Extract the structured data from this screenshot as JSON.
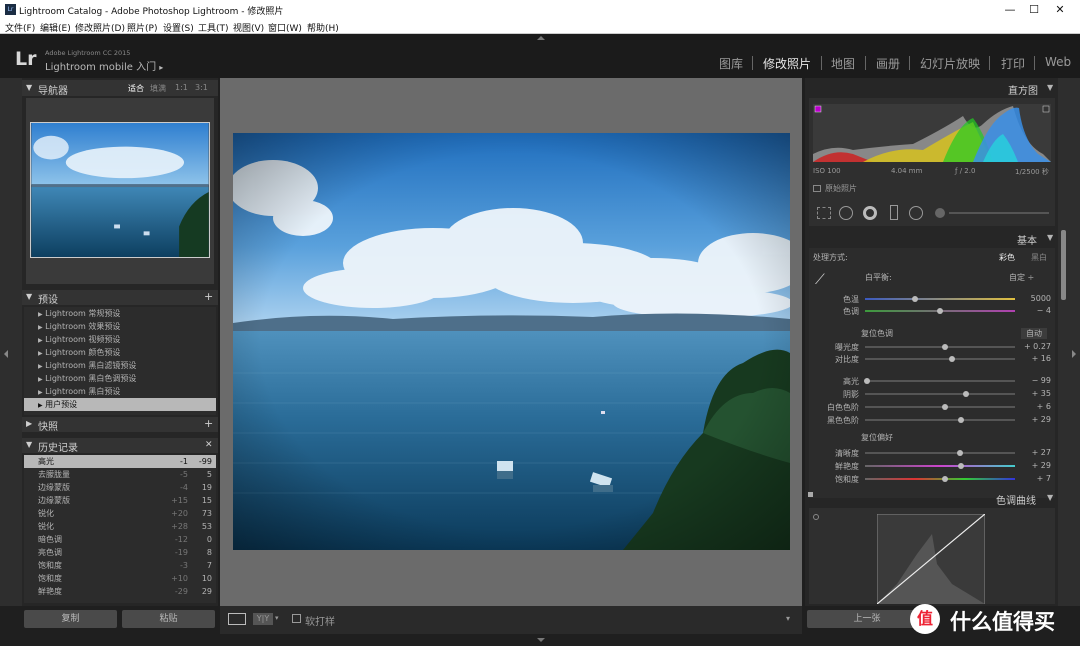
{
  "window": {
    "title": "Lightroom Catalog - Adobe Photoshop Lightroom - 修改照片",
    "min": "—",
    "max": "☐",
    "close": "✕"
  },
  "menu": [
    "文件(F)",
    "编辑(E)",
    "修改照片(D)",
    "照片(P)",
    "设置(S)",
    "工具(T)",
    "视图(V)",
    "窗口(W)",
    "帮助(H)"
  ],
  "identity": {
    "logo": "Lr",
    "line1": "Adobe Lightroom CC 2015",
    "line2": "Lightroom mobile 入门",
    "arrow": "▸"
  },
  "modules": [
    "图库",
    "修改照片",
    "地图",
    "画册",
    "幻灯片放映",
    "打印",
    "Web"
  ],
  "navigator": {
    "title": "导航器",
    "fit": "适合",
    "fill": "填满",
    "r1": "1:1",
    "r3": "3:1"
  },
  "presets": {
    "title": "预设",
    "add": "+",
    "items": [
      "Lightroom 常规预设",
      "Lightroom 效果预设",
      "Lightroom 视频预设",
      "Lightroom 颜色预设",
      "Lightroom 黑白滤镜预设",
      "Lightroom 黑白色调预设",
      "Lightroom 黑白预设",
      "用户预设"
    ]
  },
  "snapshots": {
    "title": "快照",
    "add": "+"
  },
  "history": {
    "title": "历史记录",
    "close": "✕",
    "items": [
      {
        "n": "高光",
        "a": "-1",
        "b": "-99"
      },
      {
        "n": "去朦胧量",
        "a": "-5",
        "b": "5"
      },
      {
        "n": "边缘蒙版",
        "a": "-4",
        "b": "19"
      },
      {
        "n": "边缘蒙版",
        "a": "+15",
        "b": "15"
      },
      {
        "n": "锐化",
        "a": "+20",
        "b": "73"
      },
      {
        "n": "锐化",
        "a": "+28",
        "b": "53"
      },
      {
        "n": "暗色调",
        "a": "-12",
        "b": "0"
      },
      {
        "n": "亮色调",
        "a": "-19",
        "b": "8"
      },
      {
        "n": "饱和度",
        "a": "-3",
        "b": "7"
      },
      {
        "n": "饱和度",
        "a": "+10",
        "b": "10"
      },
      {
        "n": "鲜艳度",
        "a": "-29",
        "b": "29"
      }
    ]
  },
  "left_buttons": {
    "copy": "复制",
    "paste": "粘贴"
  },
  "toolbar": {
    "softproof": "软打样"
  },
  "histogram": {
    "title": "直方图",
    "iso": "ISO 100",
    "focal": "4.04 mm",
    "aperture": "ƒ / 2.0",
    "shutter": "1/2500 秒",
    "original": "原始照片"
  },
  "basic": {
    "title": "基本",
    "treatment": "处理方式:",
    "color": "彩色",
    "bw": "黑白",
    "wb": "白平衡:",
    "wb_val": "自定 ÷",
    "temp": {
      "label": "色温",
      "val": "5000",
      "pos": 0.33
    },
    "tint": {
      "label": "色调",
      "val": "− 4",
      "pos": 0.5
    },
    "tone": "复位色调",
    "auto": "自动",
    "tone_sliders": [
      {
        "label": "曝光度",
        "val": "+ 0.27",
        "pos": 0.53
      },
      {
        "label": "对比度",
        "val": "+ 16",
        "pos": 0.58
      }
    ],
    "hl_sliders": [
      {
        "label": "高光",
        "val": "− 99",
        "pos": 0.01
      },
      {
        "label": "阴影",
        "val": "+ 35",
        "pos": 0.67
      },
      {
        "label": "白色色阶",
        "val": "+ 6",
        "pos": 0.53
      },
      {
        "label": "黑色色阶",
        "val": "+ 29",
        "pos": 0.64
      }
    ],
    "presence": "复位偏好",
    "pres_sliders": [
      {
        "label": "清晰度",
        "val": "+ 27",
        "pos": 0.63
      },
      {
        "label": "鲜艳度",
        "val": "+ 29",
        "pos": 0.64
      },
      {
        "label": "饱和度",
        "val": "+ 7",
        "pos": 0.53
      }
    ]
  },
  "curve": {
    "title": "色调曲线"
  },
  "right_buttons": {
    "prev": "上一张"
  },
  "watermark": {
    "text": "什么值得买",
    "logo": "值"
  }
}
